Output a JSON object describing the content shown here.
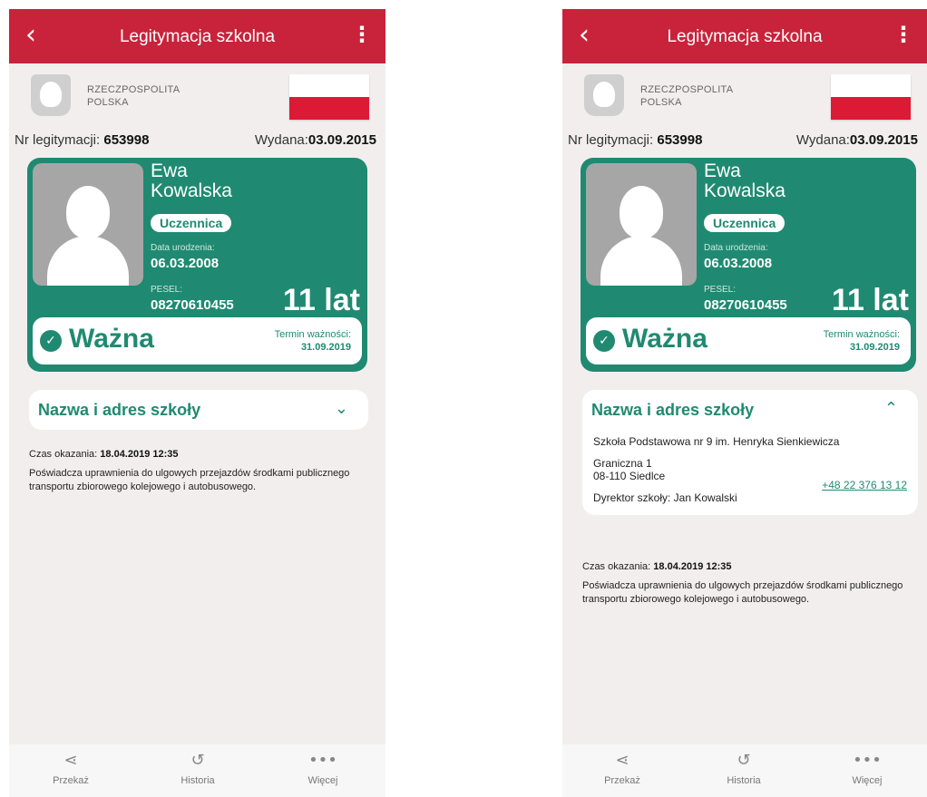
{
  "app": {
    "title": "Legitymacja szkolna",
    "back_icon": "chevron-left-icon",
    "menu_icon": "more-vertical-icon",
    "country_line1": "RZECZPOSPOLITA",
    "country_line2": "POLSKA",
    "nr_label": "Nr legitymacji:",
    "nr_value": "653998",
    "issued_label": "Wydana:",
    "issued_value": "03.09.2015",
    "first_name": "Ewa",
    "last_name": "Kowalska",
    "role": "Uczennica",
    "dob_label": "Data urodzenia:",
    "dob_value": "06.03.2008",
    "pesel_label": "PESEL:",
    "pesel_value": "08270610455",
    "age": "11 lat",
    "status": "Ważna",
    "validity_label": "Termin ważności:",
    "validity_value": "31.09.2019",
    "school_section": "Nazwa i adres szkoły",
    "school_name": "Szkoła Podstawowa nr 9 im. Henryka Sienkiewicza",
    "street": "Graniczna 1",
    "city": "08-110 Siedlce",
    "phone": "+48 22 376 13 12",
    "director": "Dyrektor szkoły: Jan Kowalski",
    "shown_label": "Czas okazania:",
    "shown_value": "18.04.2019 12:35",
    "note": "Poświadcza uprawnienia do ulgowych przejazdów środkami publicznego transportu zbiorowego kolejowego i autobusowego.",
    "nav": [
      {
        "label": "Przekaż",
        "icon": "share-icon"
      },
      {
        "label": "Historia",
        "icon": "history-icon"
      },
      {
        "label": "Więcej",
        "icon": "more-horizontal-icon"
      }
    ]
  },
  "colors": {
    "header": "#c8233a",
    "card": "#1f8a71",
    "flag_red": "#dc1a35"
  }
}
